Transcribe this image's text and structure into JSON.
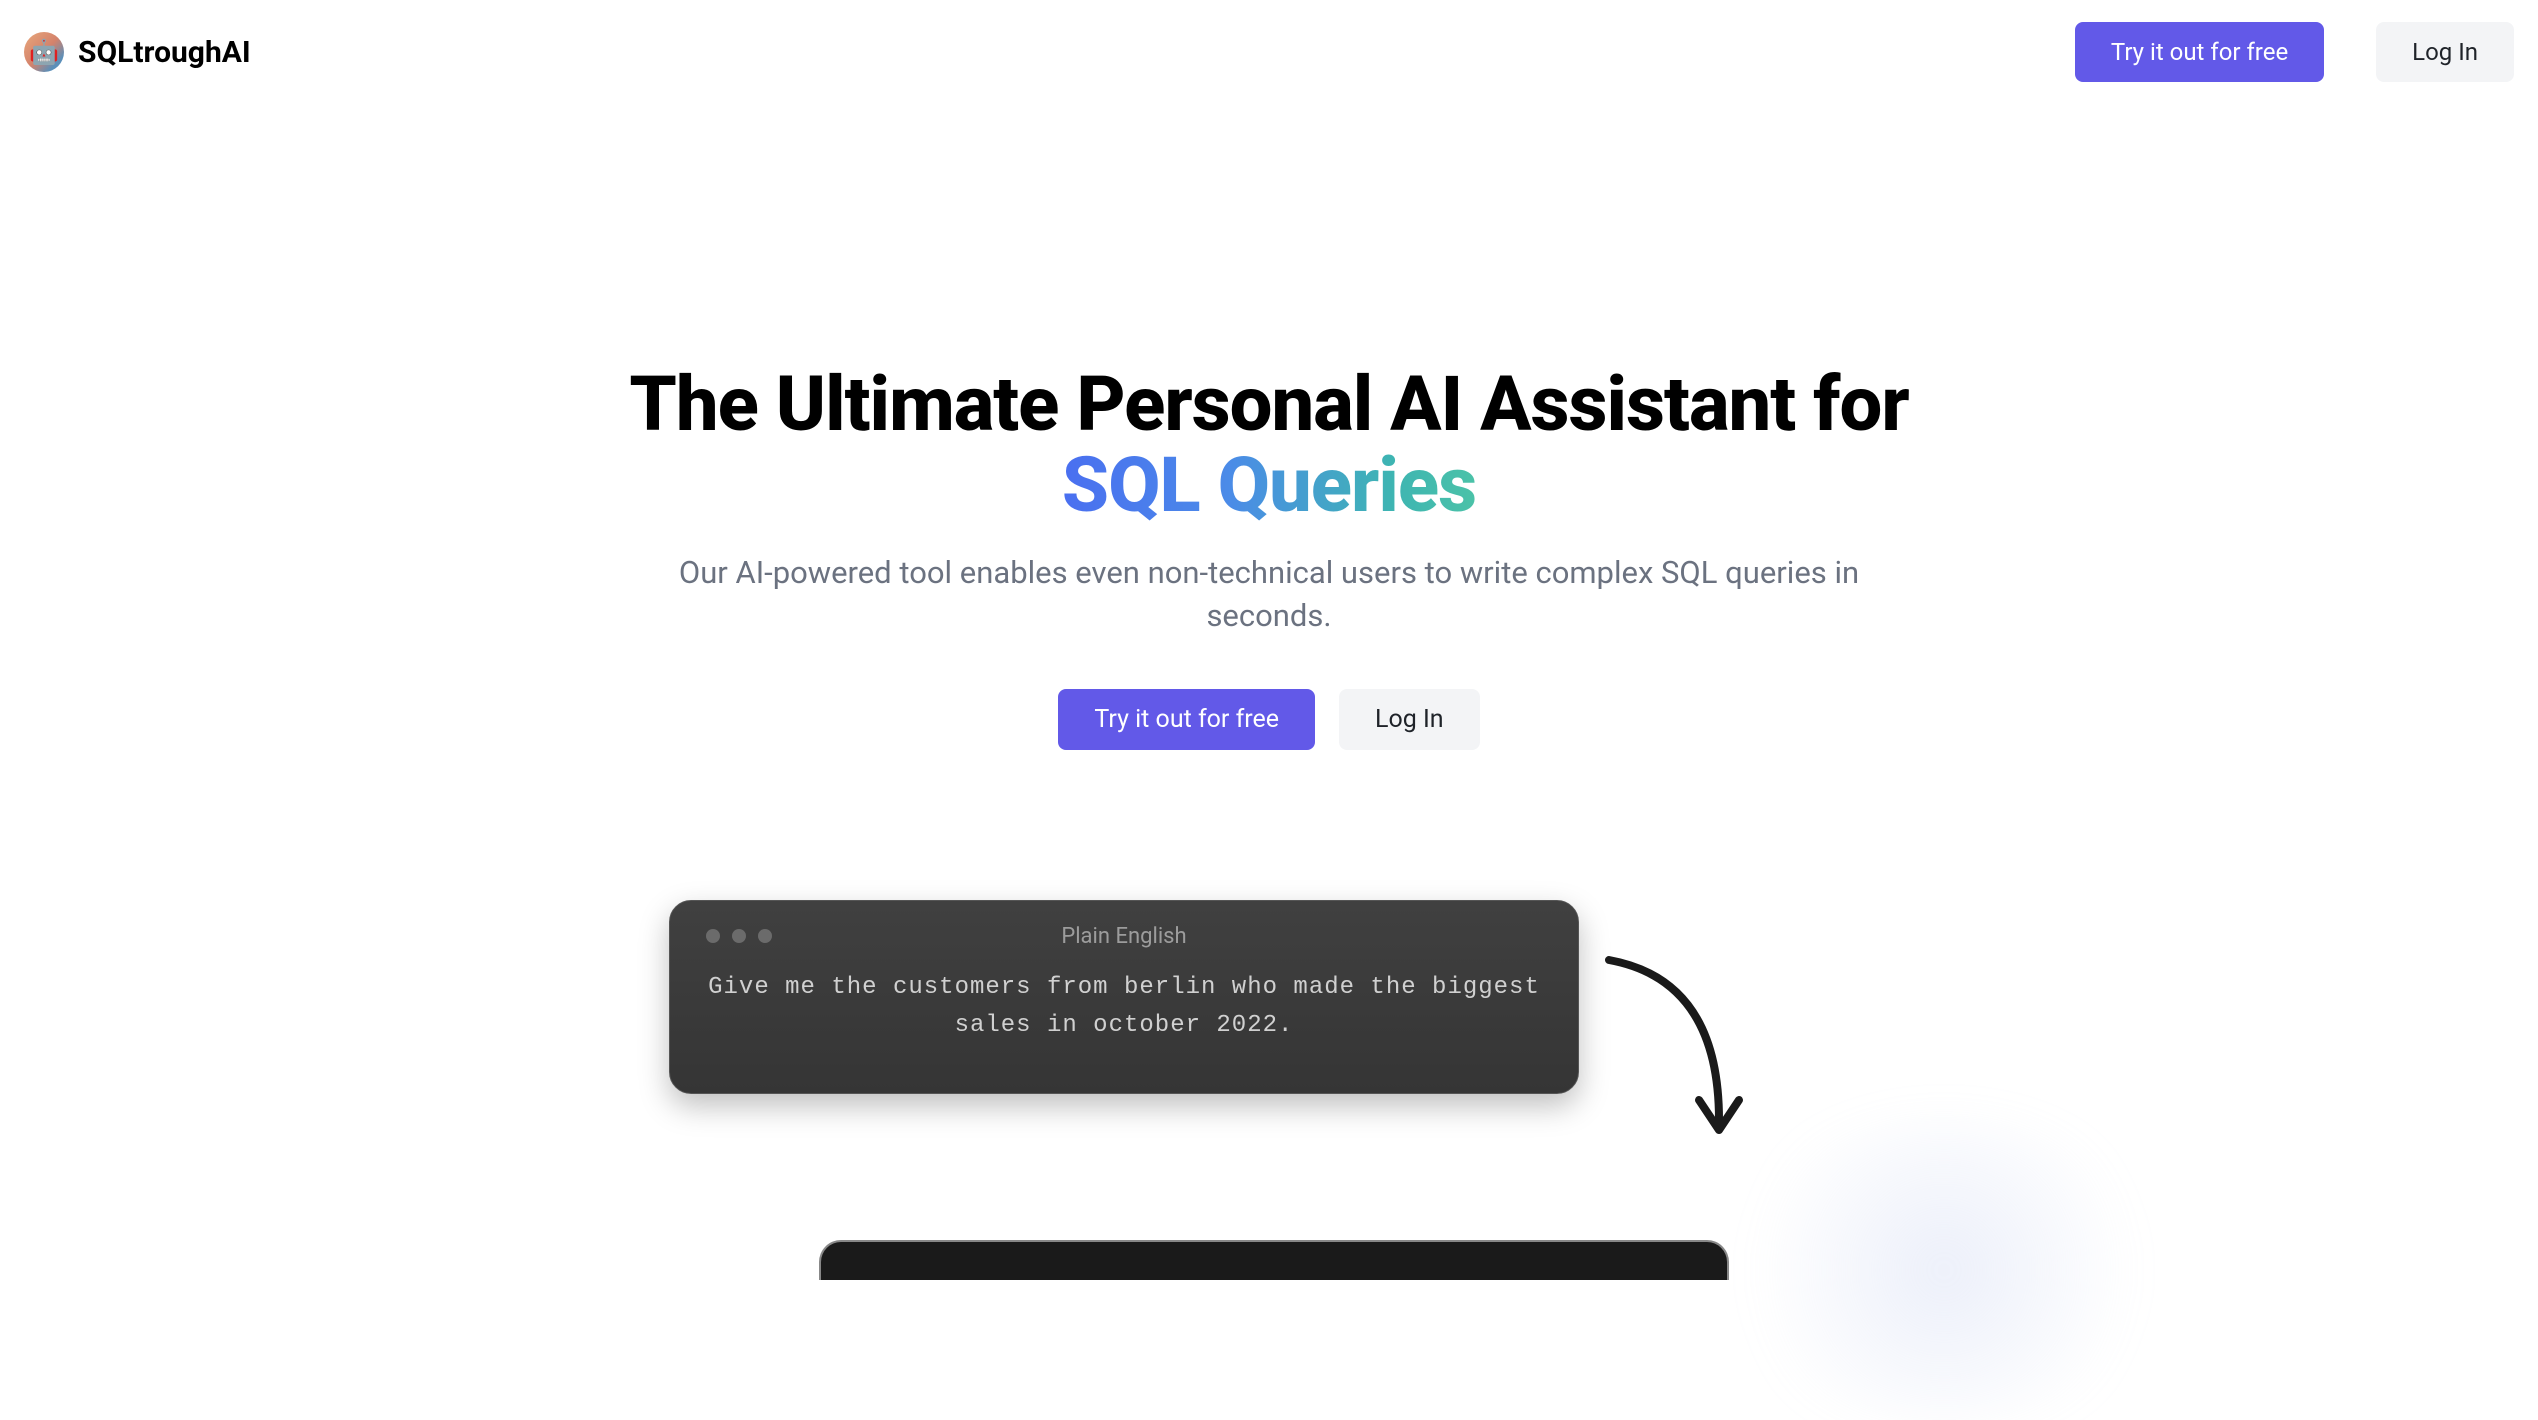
{
  "header": {
    "brand": "SQLtroughAI",
    "try_label": "Try it out for free",
    "login_label": "Log In"
  },
  "hero": {
    "title_line1": "The Ultimate Personal AI Assistant for",
    "title_gradient": "SQL Queries",
    "subtitle": "Our AI-powered tool enables even non-technical users to write complex SQL queries in seconds.",
    "try_label": "Try it out for free",
    "login_label": "Log In"
  },
  "terminal": {
    "title": "Plain English",
    "body": "Give me the customers from berlin who made the biggest sales in october 2022."
  }
}
